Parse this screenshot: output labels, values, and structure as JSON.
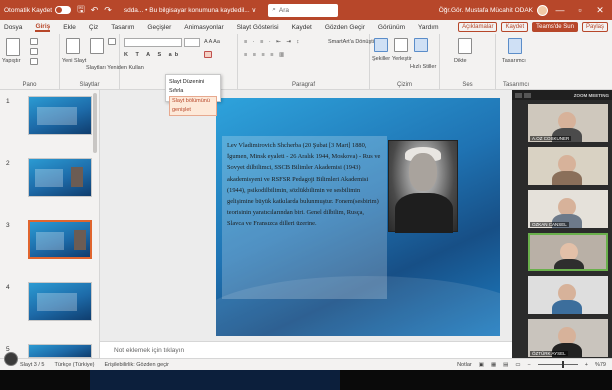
{
  "titlebar": {
    "autosave_label": "Otomatik Kaydet",
    "doc_title": "sdda... • Bu bilgisayar konumuna kaydedil... ∨",
    "search": "Ara",
    "user": "Öğr.Gör. Mustafa Mücahit ODAK",
    "win_min": "—",
    "win_max": "▫",
    "win_close": "✕"
  },
  "menu": {
    "items": [
      "Dosya",
      "Giriş",
      "Ekle",
      "Çiz",
      "Tasarım",
      "Geçişler",
      "Animasyonlar",
      "Slayt Gösterisi",
      "Kaydet",
      "Gözden Geçir",
      "Görünüm",
      "Yardım"
    ],
    "active_index": 1,
    "comment_btn": "Açıklamalar",
    "record_btn": "Kaydet",
    "present_btn": "Teams'de Sun",
    "share_btn": "Paylaş"
  },
  "ribbon": {
    "groups": [
      "Pano",
      "Slaytlar",
      "Yazı Tipi",
      "Paragraf",
      "Çizim",
      "Ses",
      "Tasarımcı"
    ],
    "paste": "Yapıştır",
    "new_slide": "Yeni Slayt",
    "reuse": "Slaytları Yeniden Kullan",
    "font_letters": "A A Aa",
    "convert_smartart": "SmartArt'a Dönüştür",
    "shapes": "Şekiller",
    "arrange": "Yerleştir",
    "quick_styles": "Hızlı Stiller",
    "dictate": "Dikte",
    "designer": "Tasarımcı"
  },
  "tooltip": {
    "line1": "Slayt Düzenini Sıfırla",
    "line2": "Slayt bölümünü genişlet"
  },
  "thumbnails": {
    "numbers": [
      "1",
      "2",
      "3",
      "4",
      "5"
    ],
    "selected_index": 2
  },
  "slide": {
    "body": "Lev Vladimirovich Shcherba (20 Şubat [3 Mart] 1880, İgumen, Minsk eyaleti - 26 Aralık 1944, Moskova) - Rus ve Sovyet dilbilimci, SSCB Bilimler Akademisi (1943) akademisyeni ve RSFSR Pedagoji Bilimleri Akademisi (1944), psikodilbilimin, sözlükbilimin ve sesbilimin gelişimine büyük katkılarda bulunmuştur. Fonem(sesbirim) teorisinin yaratıcılarından biri. Genel dilbilim, Rusça, Slavca ve Fransızca dilleri üzerine."
  },
  "video_tiles": [
    {
      "name": "A.OZ COSKUNER"
    },
    {
      "name": ""
    },
    {
      "name": "OZKAN CANSEL"
    },
    {
      "name": ""
    },
    {
      "name": ""
    },
    {
      "name": "ÖZTÜRK AYSEL"
    }
  ],
  "panel_header_label": "ZOOM MEETING",
  "notes_placeholder": "Not eklemek için tıklayın",
  "statusbar": {
    "slide_info": "Slayt 3 / 5",
    "language": "Türkçe (Türkiye)",
    "accessibility": "Erişilebilirlik: Gözden geçir",
    "notes_btn": "Notlar",
    "zoom": "%79"
  },
  "colors": {
    "accent": "#b7472a",
    "slide_blue": "#1f73b3",
    "selection": "#e0652e"
  }
}
